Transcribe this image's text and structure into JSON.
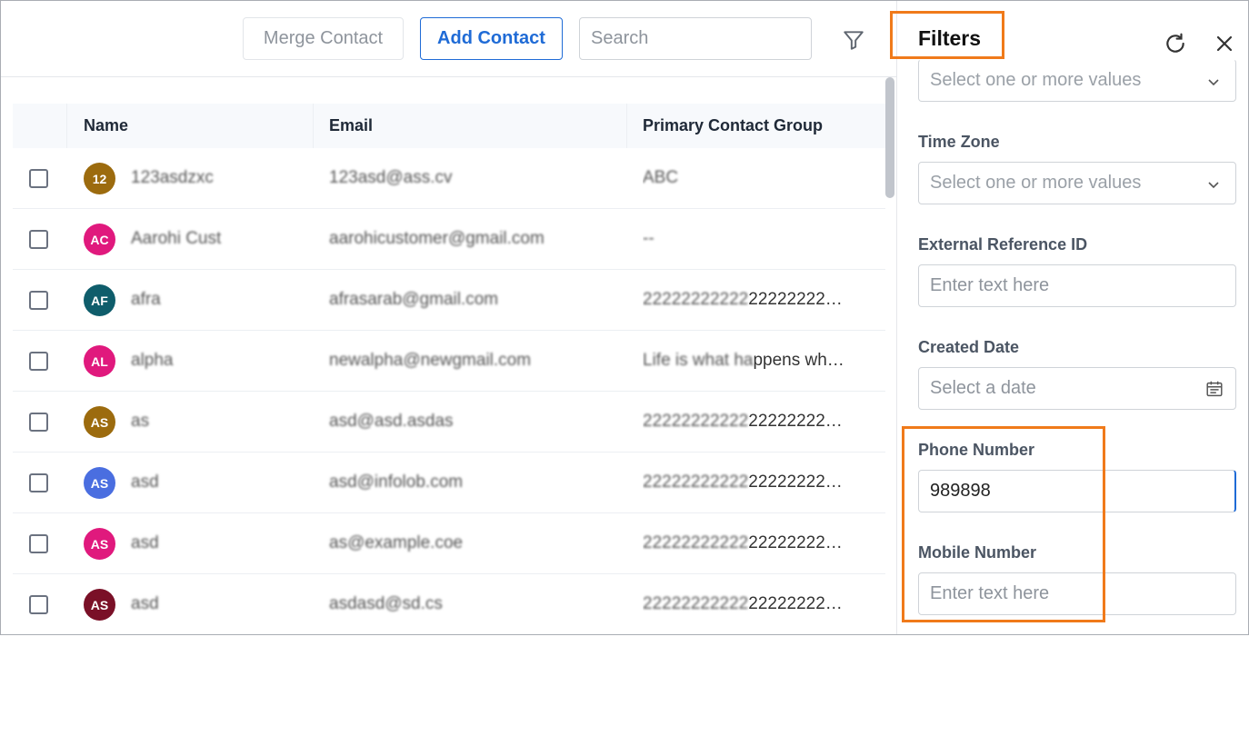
{
  "toolbar": {
    "merge_label": "Merge Contact",
    "add_label": "Add Contact",
    "search_placeholder": "Search"
  },
  "table": {
    "columns": [
      "Name",
      "Email",
      "Primary Contact Group"
    ],
    "rows": [
      {
        "initials": "12",
        "color": "#9c6b0e",
        "name": "123asdzxc",
        "email": "123asd@ass.cv",
        "group": "ABC",
        "group_clear": ""
      },
      {
        "initials": "AC",
        "color": "#e0197d",
        "name": "Aarohi Cust",
        "email": "aarohicustomer@gmail.com",
        "group": "--",
        "group_clear": ""
      },
      {
        "initials": "AF",
        "color": "#0f5d6b",
        "name": "afra",
        "email": "afrasarab@gmail.com",
        "group": "22222222222",
        "group_clear": "22222222…"
      },
      {
        "initials": "AL",
        "color": "#e0197d",
        "name": "alpha",
        "email": "newalpha@newgmail.com",
        "group": "Life is what ha",
        "group_clear": "ppens wh…"
      },
      {
        "initials": "AS",
        "color": "#9c6b0e",
        "name": "as",
        "email": "asd@asd.asdas",
        "group": "22222222222",
        "group_clear": "22222222…"
      },
      {
        "initials": "AS",
        "color": "#4a6ee0",
        "name": "asd",
        "email": "asd@infolob.com",
        "group": "22222222222",
        "group_clear": "22222222…"
      },
      {
        "initials": "AS",
        "color": "#e0197d",
        "name": "asd",
        "email": "as@example.coe",
        "group": "22222222222",
        "group_clear": "22222222…"
      },
      {
        "initials": "AS",
        "color": "#7a1027",
        "name": "asd",
        "email": "asdasd@sd.cs",
        "group": "22222222222",
        "group_clear": "22222222…"
      }
    ]
  },
  "filters": {
    "title": "Filters",
    "top_select_placeholder": "Select one or more values",
    "time_zone_label": "Time Zone",
    "time_zone_placeholder": "Select one or more values",
    "ext_ref_label": "External Reference ID",
    "ext_ref_placeholder": "Enter text here",
    "created_date_label": "Created Date",
    "created_date_placeholder": "Select a date",
    "phone_label": "Phone Number",
    "phone_value": "989898",
    "mobile_label": "Mobile Number",
    "mobile_placeholder": "Enter text here"
  },
  "colors": {
    "accent": "#1f6bd6",
    "highlight": "#f07a1a"
  }
}
